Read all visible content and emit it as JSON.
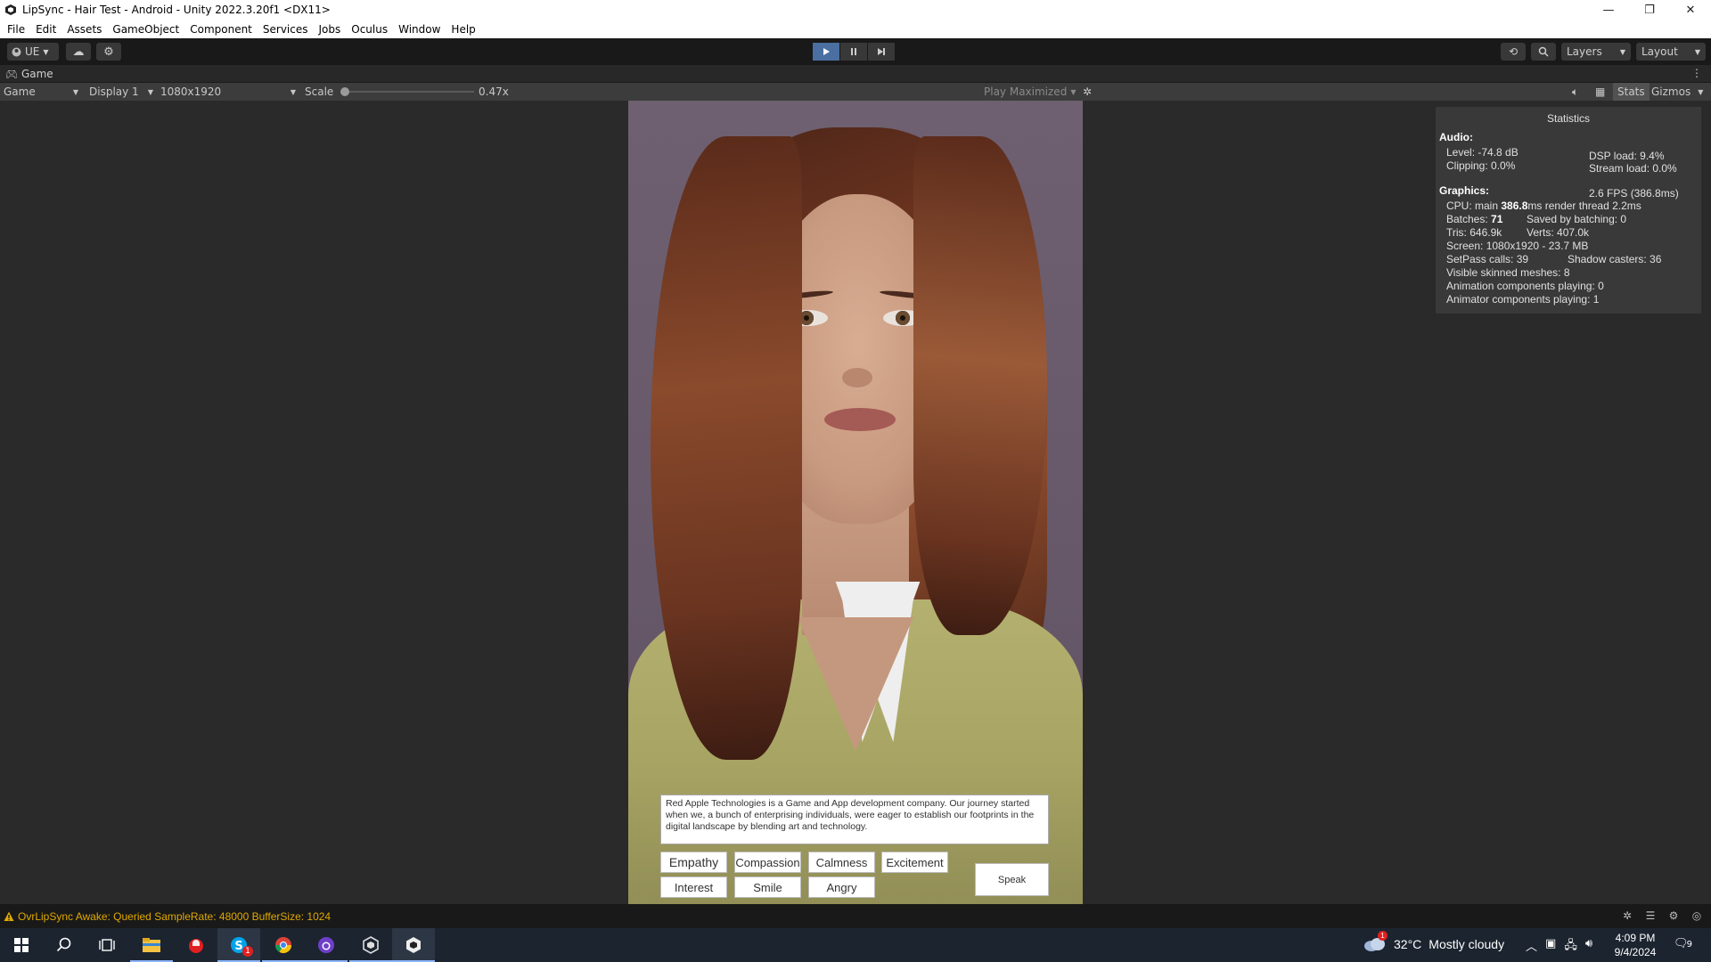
{
  "window": {
    "title": "LipSync - Hair Test - Android - Unity 2022.3.20f1 <DX11>",
    "minimize": "—",
    "restore": "❐",
    "close": "✕"
  },
  "menu": [
    "File",
    "Edit",
    "Assets",
    "GameObject",
    "Component",
    "Services",
    "Jobs",
    "Oculus",
    "Window",
    "Help"
  ],
  "toolbar": {
    "account_label": "UE",
    "layers_label": "Layers",
    "layout_label": "Layout",
    "accent": "#4a6fa0"
  },
  "game_tab": {
    "label": "Game"
  },
  "game_toolbar": {
    "mode": "Game",
    "display": "Display 1",
    "resolution": "1080x1920",
    "scale_label": "Scale",
    "scale_value": "0.47x",
    "play_mode": "Play Maximized",
    "stats_label": "Stats",
    "gizmos_label": "Gizmos"
  },
  "speech": {
    "text": "Red Apple Technologies is a Game and App development company. Our journey started when we, a bunch of enterprising individuals, were eager to establish our footprints in the digital landscape by blending art and technology."
  },
  "emotions": {
    "row1": [
      "Empathy",
      "Compassion",
      "Calmness",
      "Excitement"
    ],
    "row2": [
      "Interest",
      "Smile",
      "Angry"
    ]
  },
  "speak_label": "Speak",
  "stats": {
    "title": "Statistics",
    "audio_header": "Audio:",
    "level": "Level: -74.8 dB",
    "clipping": "Clipping: 0.0%",
    "dsp_load": "DSP load: 9.4%",
    "stream_load": "Stream load: 0.0%",
    "graphics_header": "Graphics:",
    "fps": "2.6 FPS (386.8ms)",
    "cpu_prefix": "CPU: main ",
    "cpu_main": "386.8",
    "cpu_suffix": "ms  render thread 2.2ms",
    "batches_prefix": "Batches: ",
    "batches": "71",
    "saved_batching": "Saved by batching: 0",
    "tris": "Tris: 646.9k",
    "verts": "Verts: 407.0k",
    "screen": "Screen: 1080x1920 - 23.7 MB",
    "setpass": "SetPass calls: 39",
    "shadow_casters": "Shadow casters: 36",
    "skinned": "Visible skinned meshes: 8",
    "anim_components": "Animation components playing: 0",
    "animator_components": "Animator components playing: 1"
  },
  "console": {
    "message": "OvrLipSync Awake: Queried SampleRate: 48000 BufferSize: 1024",
    "warn_color": "#e0a800"
  },
  "taskbar": {
    "weather_temp": "32°C",
    "weather_text": "Mostly cloudy",
    "weather_badge": "1",
    "time": "4:09 PM",
    "date": "9/4/2024",
    "notification_count": "9",
    "skype_badge": "1"
  }
}
